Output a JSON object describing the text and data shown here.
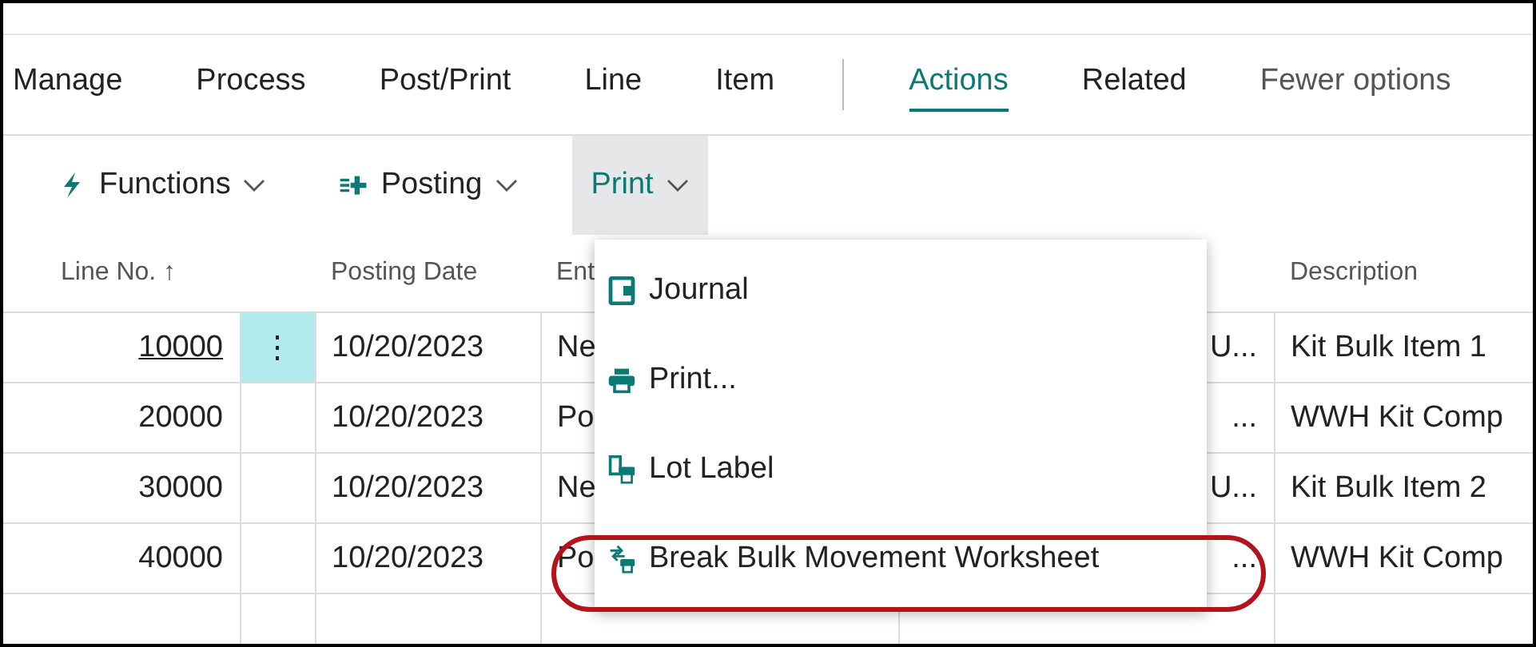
{
  "tabs": [
    {
      "label": "Manage",
      "selected": false
    },
    {
      "label": "Process",
      "selected": false
    },
    {
      "label": "Post/Print",
      "selected": false
    },
    {
      "label": "Line",
      "selected": false
    },
    {
      "label": "Item",
      "selected": false
    },
    {
      "label": "Actions",
      "selected": true
    },
    {
      "label": "Related",
      "selected": false
    },
    {
      "label": "Fewer options",
      "selected": false,
      "kind": "muted"
    }
  ],
  "action_buttons": [
    {
      "label": "Functions",
      "expanded": false
    },
    {
      "label": "Posting",
      "expanded": false
    },
    {
      "label": "Print",
      "expanded": true
    }
  ],
  "table": {
    "columns": [
      "Line No. ↑",
      "",
      "Posting Date",
      "Ent",
      "",
      "Description"
    ],
    "rows": [
      {
        "selected": true,
        "cells": [
          "10000",
          "⋮",
          "10/20/2023",
          "Ne",
          "U...",
          "Kit Bulk Item 1"
        ]
      },
      {
        "selected": false,
        "cells": [
          "20000",
          "",
          "10/20/2023",
          "Po",
          "...",
          "WWH Kit Comp"
        ]
      },
      {
        "selected": false,
        "cells": [
          "30000",
          "",
          "10/20/2023",
          "Ne",
          "U...",
          "Kit Bulk Item 2"
        ]
      },
      {
        "selected": false,
        "cells": [
          "40000",
          "",
          "10/20/2023",
          "Po",
          "...",
          "WWH Kit Comp"
        ]
      }
    ]
  },
  "print_menu": {
    "items": [
      {
        "label": "Journal",
        "highlighted": false
      },
      {
        "label": "Print...",
        "highlighted": false
      },
      {
        "label": "Lot Label",
        "highlighted": false
      },
      {
        "label": "Break Bulk Movement Worksheet",
        "highlighted": true
      }
    ]
  }
}
